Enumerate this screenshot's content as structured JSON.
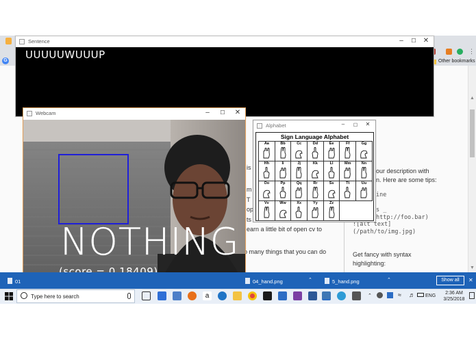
{
  "browser": {
    "bookmark_left": "G",
    "bookmark_right": "Other bookmarks"
  },
  "page": {
    "left_lines": [
      "is t",
      "m",
      "T",
      "op",
      "ts",
      "earn a little bit of open cv to",
      "o many things that you can do"
    ],
    "right_lines": [
      "our description with",
      "n. Here are some tips:",
      "ine",
      "s _",
      "http://foo.bar)",
      "![alt text]",
      "(/path/to/img.jpg)",
      "Get fancy with syntax",
      "highlighting:"
    ]
  },
  "sentence_window": {
    "title": "Sentence",
    "text": "UUUUUWUUUP"
  },
  "webcam_window": {
    "title": "Webcam",
    "prediction": "NOTHING",
    "score": "(score = 0.18409)"
  },
  "alphabet_window": {
    "title": "Alphabet",
    "heading": "Sign Language Alphabet",
    "letters": [
      "Aa",
      "Bb",
      "Cc",
      "Dd",
      "Ee",
      "Ff",
      "Gg",
      "Hh",
      "Ii",
      "Jj",
      "Kk",
      "Ll",
      "Mm",
      "Nn",
      "Oo",
      "Pp",
      "Qq",
      "Rr",
      "Ss",
      "Tt",
      "Uu",
      "Vv",
      "Ww",
      "Xx",
      "Yy",
      "Zz"
    ]
  },
  "downloads": {
    "items": [
      "01",
      "04_hand.png",
      "5_hand.png"
    ],
    "show_all": "Show all"
  },
  "taskbar": {
    "search_placeholder": "Type here to search",
    "lang": "ENG",
    "time": "2:36 AM",
    "date": "3/25/2018"
  },
  "colors": {
    "roi_box": "#1f1fd8",
    "webcam_border": "#e6a15a",
    "downloads_bar": "#1e63b8"
  }
}
